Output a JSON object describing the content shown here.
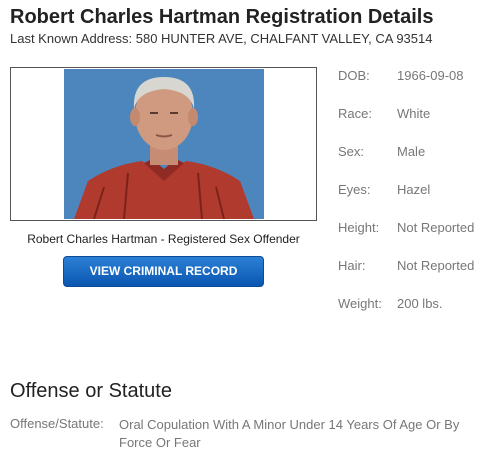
{
  "header": {
    "title": "Robert Charles Hartman Registration Details",
    "address": "Last Known Address: 580 HUNTER AVE, CHALFANT VALLEY, CA 93514"
  },
  "photo": {
    "caption": "Robert Charles Hartman - Registered Sex Offender"
  },
  "record_button": {
    "label": "VIEW CRIMINAL RECORD"
  },
  "details": [
    {
      "label": "DOB:",
      "value": "1966-09-08"
    },
    {
      "label": "Race:",
      "value": "White"
    },
    {
      "label": "Sex:",
      "value": "Male"
    },
    {
      "label": "Eyes:",
      "value": "Hazel"
    },
    {
      "label": "Height:",
      "value": "Not Reported"
    },
    {
      "label": "Hair:",
      "value": "Not Reported"
    },
    {
      "label": "Weight:",
      "value": "200 lbs."
    }
  ],
  "offense": {
    "section_title": "Offense or Statute",
    "label": "Offense/Statute:",
    "value": "Oral Copulation With A Minor Under 14 Years Of Age Or By Force Or Fear"
  },
  "colors": {
    "button": "#1a6cc8",
    "photo_background": "#4c86bd",
    "shirt": "#b03a2e"
  }
}
